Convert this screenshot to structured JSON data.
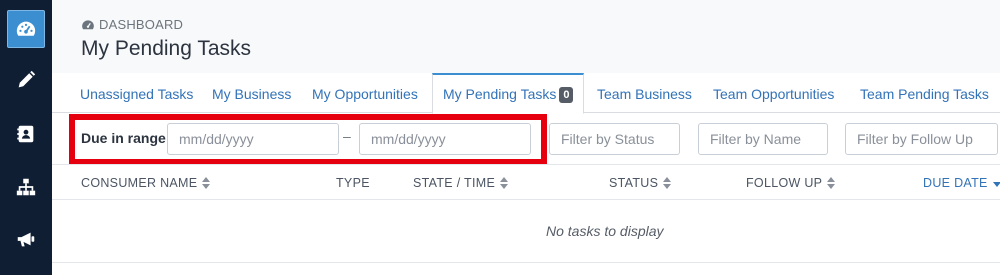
{
  "sidebar": {
    "items": [
      {
        "icon": "dashboard-icon",
        "active": true
      },
      {
        "icon": "pencil-icon",
        "active": false
      },
      {
        "icon": "contact-book-icon",
        "active": false
      },
      {
        "icon": "org-chart-icon",
        "active": false
      },
      {
        "icon": "megaphone-icon",
        "active": false
      }
    ]
  },
  "header": {
    "breadcrumb": "DASHBOARD",
    "title": "My Pending Tasks"
  },
  "tabs": [
    {
      "label": "Unassigned Tasks"
    },
    {
      "label": "My Business"
    },
    {
      "label": "My Opportunities"
    },
    {
      "label": "My Pending Tasks",
      "badge": "0",
      "active": true
    },
    {
      "label": "Team Business"
    },
    {
      "label": "Team Opportunities"
    },
    {
      "label": "Team Pending Tasks"
    }
  ],
  "filters": {
    "range_label": "Due in range",
    "date_from_placeholder": "mm/dd/yyyy",
    "range_separator": "–",
    "date_to_placeholder": "mm/dd/yyyy",
    "status_placeholder": "Filter by Status",
    "name_placeholder": "Filter by Name",
    "follow_up_placeholder": "Filter by Follow Up"
  },
  "table": {
    "columns": [
      {
        "label": "CONSUMER NAME",
        "sortable": true
      },
      {
        "label": "TYPE",
        "sortable": false
      },
      {
        "label": "STATE / TIME",
        "sortable": true
      },
      {
        "label": "STATUS",
        "sortable": true
      },
      {
        "label": "FOLLOW UP",
        "sortable": true
      },
      {
        "label": "DUE DATE",
        "sortable": true,
        "sorted": "desc"
      }
    ],
    "empty_message": "No tasks to display"
  },
  "colors": {
    "sidebar_bg": "#0f1e33",
    "accent": "#3b8fd1",
    "link": "#3273b8",
    "highlight": "#e6000f"
  }
}
